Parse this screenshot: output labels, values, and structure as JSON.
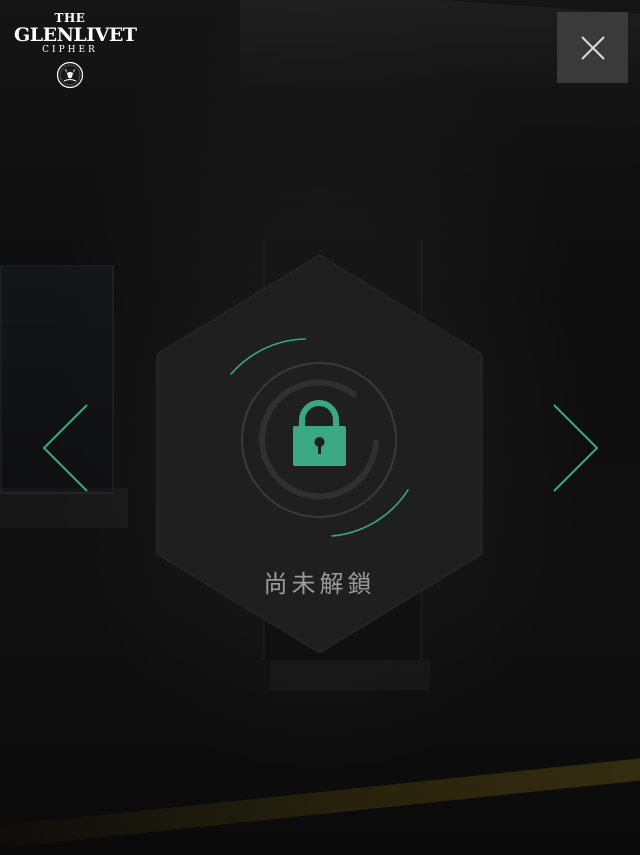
{
  "logo": {
    "the": "THE",
    "brand": "GLENLIVET",
    "sub": "CIPHER",
    "emblem_icon": "stag-emblem-icon"
  },
  "close_button": {
    "icon": "close-icon"
  },
  "navigation": {
    "prev_icon": "chevron-left-icon",
    "next_icon": "chevron-right-icon"
  },
  "card": {
    "lock_icon": "padlock-icon",
    "status_label": "尚未解鎖"
  },
  "colors": {
    "accent": "#3aa883",
    "card_bg": "#1f1f1f",
    "close_bg": "#3a3a3a",
    "label": "#9a9a9a"
  }
}
